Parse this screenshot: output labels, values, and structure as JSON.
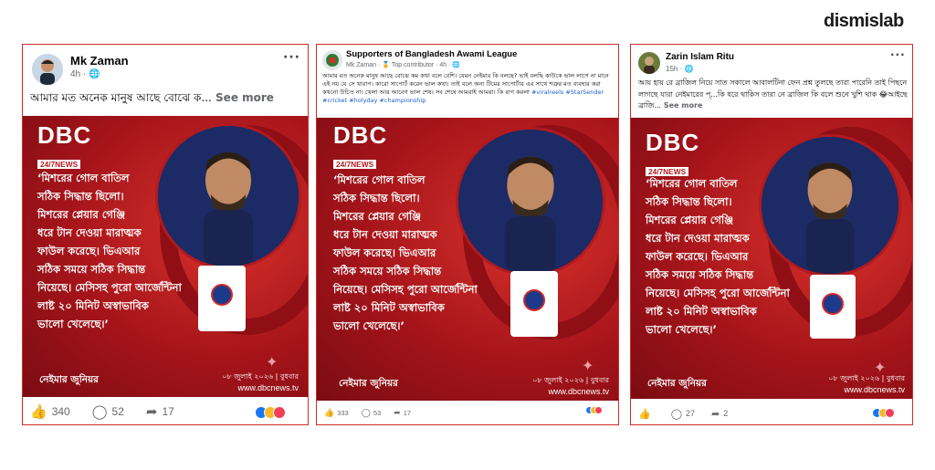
{
  "brand": "dismislab",
  "posts": [
    {
      "name": "Mk Zaman",
      "meta": "4h · 🌐",
      "text": "আমার মত অনেক মানুষ আছে বোঝে ক...",
      "see_more": " See more",
      "card": {
        "logo_big": "DBC",
        "logo_small": "24/7NEWS",
        "quote": [
          "‘মিশরের গোল বাতিল",
          "সঠিক সিদ্ধান্ত ছিলো।",
          "মিশরের প্লেয়ার গেঞ্জি",
          "ধরে টান দেওয়া মারাত্মক",
          "ফাউল করেছে। ভিএআর",
          "সঠিক সময়ে সঠিক সিদ্ধান্ত",
          "নিয়েছে। মেসিসহ পুরো আর্জেন্টিনা",
          "লাষ্ট ২০ মিনিট অস্বাভাবিক",
          "ভালো খেলেছে।’"
        ],
        "author": "নেইমার জুনিয়র",
        "date": "০৮ জুলাই ২০২৬ | বুধবার",
        "site": "www.dbcnews.tv"
      },
      "likes": "340",
      "comments": "52",
      "shares": "17"
    },
    {
      "name": "Supporters of Bangladesh Awami League",
      "meta": "Mk Zaman · 🏅 Top contributor · 4h · 🌐",
      "text": "আমার মত অনেক মানুষ আছে বোঝে কম কথা বলে বেশি। যেমন নেইমার কি বলছে? ভাই বলছি কাউকে ভাল লাগে না মানে এই নয় যে সে খারাপ। কারো সাপোর্ট করেন ভাল কথা। তাই বলে অন্য টিমের সাপোর্টার এর সাথে শত্রুর মত ব্যবহার করা কখনো উচিত না। খেলা আর আবেগ ভাল শেষ। সব শেষে আমরাই আমরা। কি রাগ করলা",
      "hashtags": " #viralreels #StarSender #cricket #holyday #championship",
      "card": {
        "logo_big": "DBC",
        "logo_small": "24/7NEWS",
        "quote": [
          "‘মিশরের গোল বাতিল",
          "সঠিক সিদ্ধান্ত ছিলো।",
          "মিশরের প্লেয়ার গেঞ্জি",
          "ধরে টান দেওয়া মারাত্মক",
          "ফাউল করেছে। ভিএআর",
          "সঠিক সময়ে সঠিক সিদ্ধান্ত",
          "নিয়েছে। মেসিসহ পুরো আর্জেন্টিনা",
          "লাষ্ট ২০ মিনিট অস্বাভাবিক",
          "ভালো খেলেছে।’"
        ],
        "author": "নেইমার জুনিয়র",
        "date": "০৮ জুলাই ২০২৬ | বুধবার",
        "site": "www.dbcnews.tv"
      },
      "likes": "333",
      "comments": "53",
      "shares": "17"
    },
    {
      "name": "Zarin Islam Ritu",
      "meta": "15h · 🌐",
      "text": "আয় হায় রে ব্রাজিল নিয়ে সাত সকালে আবালটিনা ফেন প্রশ্ন তুলছে তারা পারেনি তাই পিছনে লাগছে যারা নেইমারের প্...কি ধরে থাকিস তারা নে ব্রাজিল কি বলে শুনে খুশি থাক 😂আইছে ব্রাজি...",
      "see_more": " See more",
      "card": {
        "logo_big": "DBC",
        "logo_small": "24/7NEWS",
        "quote": [
          "‘মিশরের গোল বাতিল",
          "সঠিক সিদ্ধান্ত ছিলো।",
          "মিশরের প্লেয়ার গেঞ্জি",
          "ধরে টান দেওয়া মারাত্মক",
          "ফাউল করেছে। ভিএআর",
          "সঠিক সময়ে সঠিক সিদ্ধান্ত",
          "নিয়েছে। মেসিসহ পুরো আর্জেন্টিনা",
          "লাষ্ট ২০ মিনিট অস্বাভাবিক",
          "ভালো খেলেছে।’"
        ],
        "author": "নেইমার জুনিয়র",
        "date": "০৮ জুলাই ২০২৬ | বুধবার",
        "site": "www.dbcnews.tv"
      },
      "likes": "",
      "comments": "27",
      "shares": "2"
    }
  ],
  "colors": {
    "border": "#d02a2a",
    "card_red": "#b51a1f",
    "link": "#1b5fd1"
  }
}
